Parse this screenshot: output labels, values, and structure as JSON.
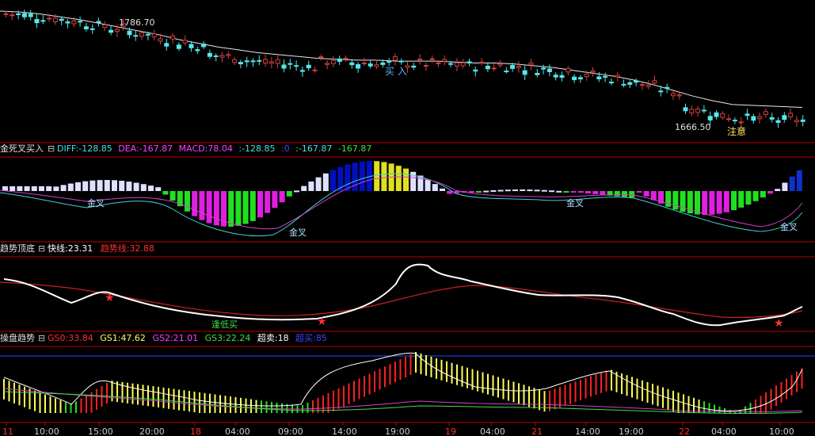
{
  "colors": {
    "background": "#000000",
    "separator": "#c00000",
    "candle_up": "#d04040",
    "candle_down": "#54e8ec",
    "ma_line": "#e8e8e8",
    "axis_text": "#cccccc"
  },
  "chart_data": [
    {
      "type": "candlestick",
      "panel": "price",
      "annotations": {
        "high_label": "1786.70",
        "low_label": "1666.50",
        "buy_label": "买 入",
        "caution_label": "注意"
      },
      "ylim": [
        1656,
        1792
      ],
      "ma_line": [
        1787,
        1786,
        1784,
        1781,
        1778,
        1774,
        1770,
        1766,
        1762,
        1757,
        1753,
        1749,
        1746,
        1743,
        1741,
        1739,
        1737,
        1736,
        1735,
        1735,
        1734,
        1734,
        1734,
        1733,
        1732,
        1732,
        1731,
        1729,
        1727,
        1724,
        1721,
        1718,
        1714,
        1709,
        1703,
        1697,
        1692,
        1688,
        1685
      ],
      "ma_x": [
        0,
        25,
        50,
        75,
        100,
        125,
        150,
        175,
        200,
        225,
        250,
        275,
        300,
        325,
        350,
        375,
        400,
        425,
        450,
        475,
        500,
        525,
        550,
        575,
        600,
        625,
        650,
        675,
        700,
        725,
        750,
        775,
        800,
        825,
        850,
        875,
        900,
        925,
        1013
      ]
    },
    {
      "type": "bar",
      "panel": "macd",
      "title": "金死叉买入",
      "legend": [
        {
          "name": "DIFF",
          "value": "-128.85",
          "color": "#40e0e0"
        },
        {
          "name": "DEA",
          "value": "-167.87",
          "color": "#ff40ff"
        },
        {
          "name": "MACD",
          "value": "78.04",
          "color": "#ff40ff"
        },
        {
          "name": "",
          "value": ":-128.85",
          "color": "#40e0e0"
        },
        {
          "name": "",
          "value": ":0",
          "color": "#4040ff"
        },
        {
          "name": "",
          "value": ":-167.87",
          "color": "#40e0e0"
        },
        {
          "name": "",
          "value": "-167.87",
          "color": "#40e040"
        }
      ],
      "markers": [
        {
          "label": "金叉",
          "x": 110
        },
        {
          "label": "金叉",
          "x": 365
        },
        {
          "label": "金叉",
          "x": 715
        },
        {
          "label": "金叉",
          "x": 985
        }
      ]
    },
    {
      "type": "line",
      "panel": "trend",
      "title": "趋势顶底",
      "legend": [
        {
          "name": "快线",
          "value": "23.31",
          "color": "#ffffff"
        },
        {
          "name": "趋势线",
          "value": "32.88",
          "color": "#ff3030"
        }
      ],
      "annotation": "逢低买"
    },
    {
      "type": "bar",
      "panel": "operation",
      "title": "操盘趋势",
      "legend": [
        {
          "name": "GS0",
          "value": "33.84",
          "color": "#ff3030"
        },
        {
          "name": "GS1",
          "value": "47.62",
          "color": "#ffff60"
        },
        {
          "name": "GS2",
          "value": "21.01",
          "color": "#ff40ff"
        },
        {
          "name": "GS3",
          "value": "22.24",
          "color": "#40e040"
        },
        {
          "name": "超卖",
          "value": "18",
          "color": "#ffffff"
        },
        {
          "name": "超买",
          "value": "85",
          "color": "#4040ff"
        }
      ]
    }
  ],
  "x_axis": {
    "ticks": [
      "11",
      "10:00",
      "15:00",
      "20:00",
      "18",
      "04:00",
      "09:00",
      "14:00",
      "19:00",
      "19",
      "04:00",
      "21",
      "14:00",
      "19:00",
      "22",
      "04:00",
      "10:00"
    ],
    "tick_x": [
      8,
      57,
      125,
      190,
      245,
      298,
      365,
      433,
      500,
      567,
      620,
      676,
      740,
      795,
      862,
      912,
      985
    ]
  }
}
